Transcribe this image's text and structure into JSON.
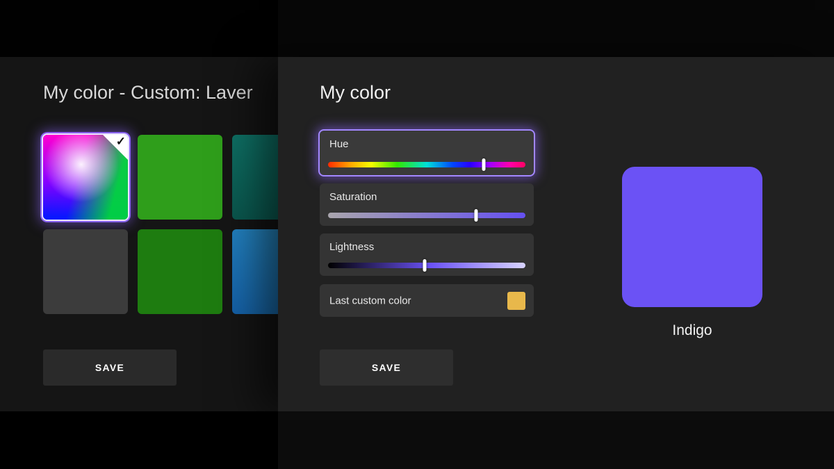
{
  "background_screen": {
    "title": "My color - Custom: Laver",
    "save_label": "SAVE",
    "swatches": [
      {
        "name": "custom-rainbow",
        "selected": true,
        "bg": "radial-gradient(circle at 45% 35%, rgba(255,255,255,0.95) 0%, rgba(255,255,255,0) 52%), linear-gradient(105deg, rgba(0,210,70,0) 42%, rgba(0,215,60,0.95) 82%), linear-gradient(to bottom, #ff00d0 0%, #8800ff 55%, #0018ff 100%)"
      },
      {
        "name": "green",
        "bg": "#2f9e1b"
      },
      {
        "name": "teal",
        "bg": "linear-gradient(to top right, #0a564d 0%, #12897b 100%)"
      },
      {
        "name": "gray",
        "bg": "#3c3c3c"
      },
      {
        "name": "dark-green",
        "bg": "#1e7c10"
      },
      {
        "name": "blue",
        "bg": "linear-gradient(to top right, #1460a8 0%, #2f9fd8 100%)"
      }
    ]
  },
  "dialog": {
    "title": "My color",
    "sliders": [
      {
        "label": "Hue",
        "value_pct": 79,
        "focused": true,
        "track": "linear-gradient(to right, #ff2a00 0%, #ffae00 12%, #f5ff00 22%, #33e800 35%, #00e0d8 50%, #0048ff 63%, #2a00ff 72%, #a000ff 82%, #ff00aa 92%, #ff0062 100%)"
      },
      {
        "label": "Saturation",
        "value_pct": 75,
        "track": "linear-gradient(to right, #a9a5ad 0%, #6550f2 100%)"
      },
      {
        "label": "Lightness",
        "value_pct": 49,
        "track": "linear-gradient(to right, #000000 0%, #6b52f6 52%, #d8d3ff 100%)"
      }
    ],
    "last_custom": {
      "label": "Last custom color",
      "color": "#e8b84b"
    },
    "save_label": "SAVE",
    "preview": {
      "label": "Indigo",
      "color": "#6b52f5"
    }
  }
}
